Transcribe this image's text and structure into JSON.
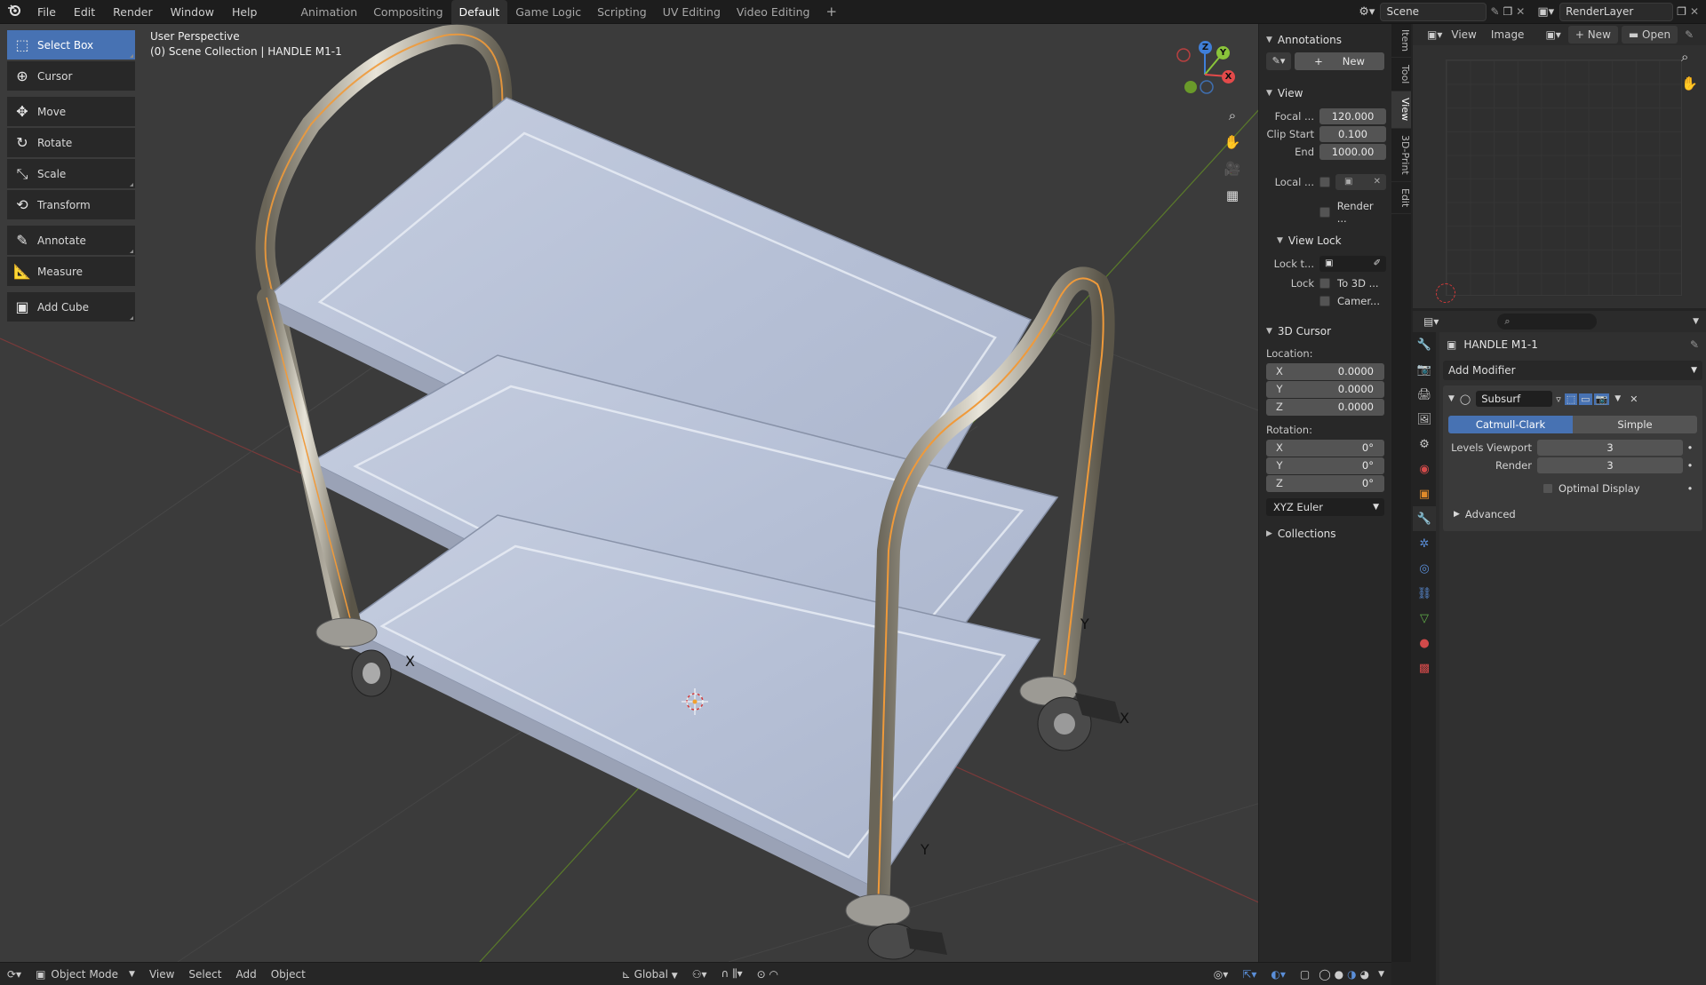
{
  "menu": [
    "File",
    "Edit",
    "Render",
    "Window",
    "Help"
  ],
  "workspaces": [
    "Animation",
    "Compositing",
    "Default",
    "Game Logic",
    "Scripting",
    "UV Editing",
    "Video Editing"
  ],
  "active_workspace": "Default",
  "add_workspace": "+",
  "scene": "Scene",
  "render_layer": "RenderLayer",
  "viewport": {
    "title": "User Perspective",
    "subtitle": "(0) Scene Collection | HANDLE M1-1",
    "gizmo": {
      "z": "Z",
      "y": "Y",
      "x": "X"
    },
    "wheel_axes": {
      "x": "X",
      "y": "Y"
    }
  },
  "tools": [
    {
      "label": "Select Box",
      "icon": "select-box-icon",
      "active": true
    },
    {
      "label": "Cursor",
      "icon": "cursor-icon"
    },
    {
      "label": "Move",
      "icon": "move-icon"
    },
    {
      "label": "Rotate",
      "icon": "rotate-icon"
    },
    {
      "label": "Scale",
      "icon": "scale-icon"
    },
    {
      "label": "Transform",
      "icon": "transform-icon"
    },
    {
      "label": "Annotate",
      "icon": "annotate-icon"
    },
    {
      "label": "Measure",
      "icon": "measure-icon"
    },
    {
      "label": "Add Cube",
      "icon": "add-cube-icon"
    }
  ],
  "npanel": {
    "annotations": "Annotations",
    "new_label": "New",
    "view": "View",
    "focal_label": "Focal ...",
    "focal": "120.000",
    "clip_start_label": "Clip Start",
    "clip_start": "0.100",
    "end_label": "End",
    "end": "1000.00",
    "local_label": "Local ...",
    "render_label": "Render ...",
    "view_lock": "View Lock",
    "lock_to_label": "Lock t...",
    "lock_label": "Lock",
    "to_3d_label": "To 3D ...",
    "camera_label": "Camer...",
    "cursor3d": "3D Cursor",
    "location_label": "Location:",
    "loc": {
      "x": "0.0000",
      "y": "0.0000",
      "z": "0.0000"
    },
    "rotation_label": "Rotation:",
    "rot": {
      "x": "0°",
      "y": "0°",
      "z": "0°"
    },
    "axes": {
      "x": "X",
      "y": "Y",
      "z": "Z"
    },
    "rotation_mode": "XYZ Euler",
    "collections": "Collections"
  },
  "side_tabs": [
    "Item",
    "Tool",
    "View",
    "3D-Print",
    "Edit"
  ],
  "image_editor": {
    "view": "View",
    "image": "Image",
    "new": "New",
    "open": "Open"
  },
  "properties": {
    "object_name": "HANDLE M1-1",
    "add_modifier": "Add Modifier",
    "modifier_name": "Subsurf",
    "catmull": "Catmull-Clark",
    "simple": "Simple",
    "levels_viewport_label": "Levels Viewport",
    "levels_viewport": "3",
    "render_label": "Render",
    "render": "3",
    "optimal_display": "Optimal Display",
    "advanced": "Advanced"
  },
  "bottom": {
    "mode": "Object Mode",
    "view": "View",
    "select": "Select",
    "add": "Add",
    "object": "Object",
    "transform_orientation": "Global"
  }
}
